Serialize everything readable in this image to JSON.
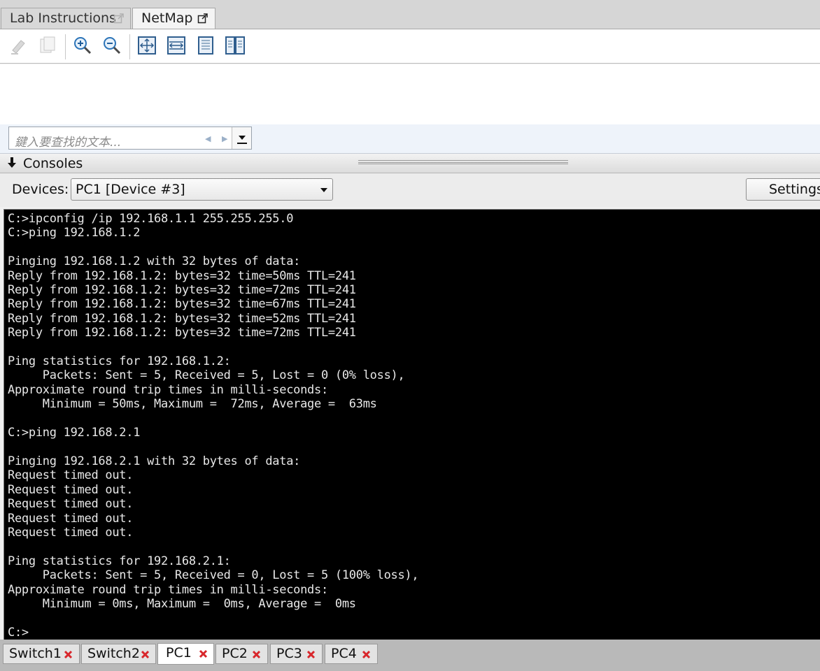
{
  "tabs": [
    {
      "label": "Lab Instructions"
    },
    {
      "label": "NetMap"
    }
  ],
  "toolbar": {
    "icons": [
      "highlighter-icon",
      "copy-icon",
      "zoom-in-icon",
      "zoom-out-icon",
      "fit-page-icon",
      "fit-width-icon",
      "single-page-icon",
      "two-page-icon"
    ]
  },
  "find": {
    "placeholder": "鍵入要查找的文本..."
  },
  "consoles": {
    "title": "Consoles",
    "devices_label": "Devices:",
    "selected_device": "PC1 [Device #3]",
    "settings_label": "Settings..."
  },
  "console": {
    "text": "C:>ipconfig /ip 192.168.1.1 255.255.255.0\nC:>ping 192.168.1.2\n\nPinging 192.168.1.2 with 32 bytes of data:\nReply from 192.168.1.2: bytes=32 time=50ms TTL=241\nReply from 192.168.1.2: bytes=32 time=72ms TTL=241\nReply from 192.168.1.2: bytes=32 time=67ms TTL=241\nReply from 192.168.1.2: bytes=32 time=52ms TTL=241\nReply from 192.168.1.2: bytes=32 time=72ms TTL=241\n\nPing statistics for 192.168.1.2:\n     Packets: Sent = 5, Received = 5, Lost = 0 (0% loss),\nApproximate round trip times in milli-seconds:\n     Minimum = 50ms, Maximum =  72ms, Average =  63ms\n\nC:>ping 192.168.2.1\n\nPinging 192.168.2.1 with 32 bytes of data:\nRequest timed out.\nRequest timed out.\nRequest timed out.\nRequest timed out.\nRequest timed out.\n\nPing statistics for 192.168.2.1:\n     Packets: Sent = 5, Received = 0, Lost = 5 (100% loss),\nApproximate round trip times in milli-seconds:\n     Minimum = 0ms, Maximum =  0ms, Average =  0ms\n\nC:>"
  },
  "device_tabs": [
    {
      "label": "Switch1",
      "active": false
    },
    {
      "label": "Switch2",
      "active": false
    },
    {
      "label": "PC1",
      "active": true
    },
    {
      "label": "PC2",
      "active": false
    },
    {
      "label": "PC3",
      "active": false
    },
    {
      "label": "PC4",
      "active": false
    }
  ],
  "colors": {
    "console_bg": "#000000",
    "console_fg": "#e8e8e8",
    "close_x": "#d8262b"
  }
}
